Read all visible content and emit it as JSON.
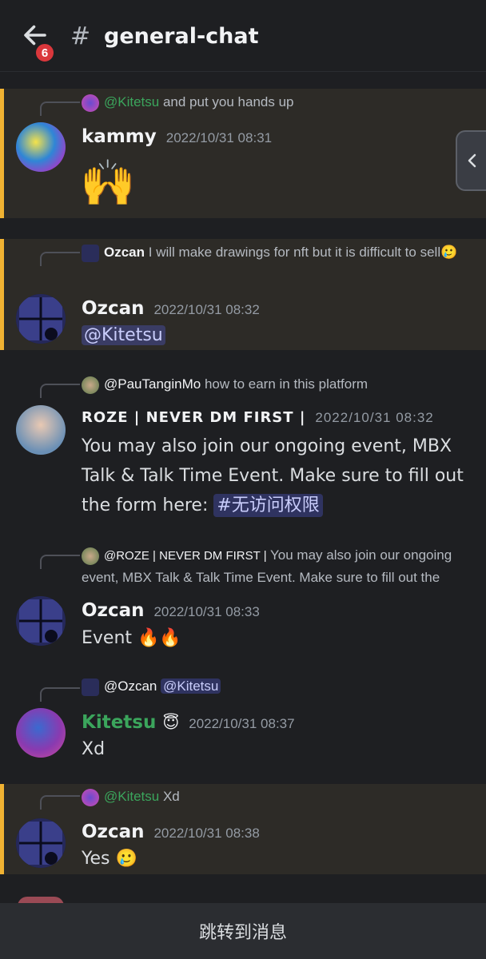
{
  "header": {
    "badge_count": "6",
    "channel_hash": "#",
    "channel_name": "general-chat"
  },
  "messages": [
    {
      "reply_to": "@Kitetsu",
      "reply_text": "and put you hands up",
      "author": "kammy",
      "timestamp": "2022/10/31 08:31",
      "content": "🙌"
    },
    {
      "reply_to": "Ozcan",
      "reply_text": "I will make drawings for nft but it is difficult to sell🥲",
      "author": "Ozcan",
      "timestamp": "2022/10/31 08:32",
      "content": "@Kitetsu"
    },
    {
      "reply_to": "@PauTanginMo",
      "reply_text": "how to earn in this platform",
      "author": "ROZE | NEVER DM FIRST |",
      "timestamp": "2022/10/31 08:32",
      "content": "You may also join our ongoing event, MBX Talk & Talk Time Event. Make sure to fill out the form here:",
      "channel_mention": "#无访问权限"
    },
    {
      "reply_to": "@ROZE | NEVER DM FIRST |",
      "reply_text": "You may also join our ongoing event, MBX Talk & Talk Time Event. Make sure to fill out the",
      "author": "Ozcan",
      "timestamp": "2022/10/31 08:33",
      "content": "Event 🔥🔥"
    },
    {
      "reply_to": "@Ozcan",
      "reply_mention": "@Kitetsu",
      "author": "Kitetsu",
      "author_emoji": "😇",
      "timestamp": "2022/10/31 08:37",
      "content": "Xd"
    },
    {
      "reply_to": "@Kitetsu",
      "reply_text": "Xd",
      "author": "Ozcan",
      "timestamp": "2022/10/31 08:38",
      "content": "Yes 🥲"
    }
  ],
  "bottom_bar": {
    "label": "跳转到消息"
  },
  "colors": {
    "background": "#1e1f22",
    "highlight": "#2d2b27",
    "highlight_border": "#f0b232",
    "mention": "#c9cdfb",
    "green_name": "#3ba55c",
    "badge": "#da373c"
  }
}
